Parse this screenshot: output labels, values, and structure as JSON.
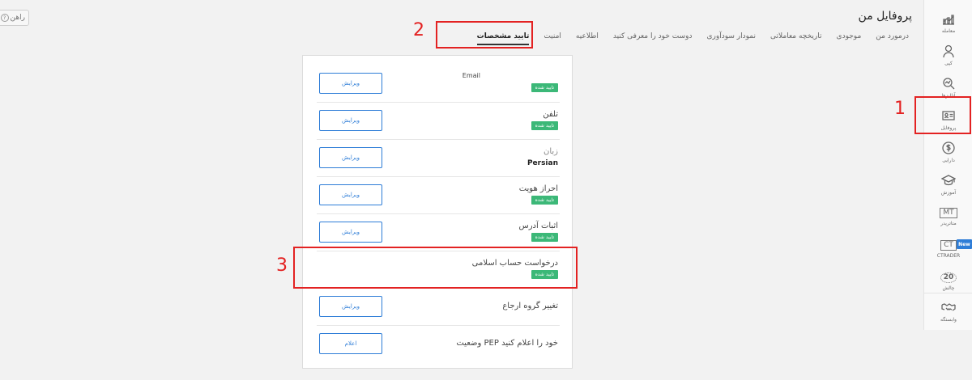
{
  "help": {
    "label": "راهن"
  },
  "page": {
    "title": "پروفایل من"
  },
  "tabs": [
    {
      "label": "درمورد من",
      "active": false
    },
    {
      "label": "موجودی",
      "active": false
    },
    {
      "label": "تاریخچه معاملاتی",
      "active": false
    },
    {
      "label": "نمودار سودآوری",
      "active": false
    },
    {
      "label": "دوست خود را معرفی کنید",
      "active": false
    },
    {
      "label": "اطلاعیه",
      "active": false
    },
    {
      "label": "امنیت",
      "active": false
    },
    {
      "label": "تایید مشخصات",
      "active": true
    }
  ],
  "sidebar": {
    "items": [
      {
        "label": "معامله",
        "icon": "trade-chart-icon"
      },
      {
        "label": "کپی",
        "icon": "copy-user-icon"
      },
      {
        "label": "آنالیزها",
        "icon": "analysis-icon"
      },
      {
        "label": "پروفایل",
        "icon": "profile-card-icon"
      },
      {
        "label": "دارایی",
        "icon": "dollar-icon"
      },
      {
        "label": "آموزش",
        "icon": "education-cap-icon"
      },
      {
        "label": "متاتریدر",
        "icon": "mt-icon",
        "text": "MT"
      },
      {
        "label": "CTRADER",
        "icon": "ct-icon",
        "text": "CT"
      },
      {
        "label": "چالش",
        "icon": "challenge-20-icon",
        "text": "20"
      },
      {
        "label": "وابستگه",
        "icon": "handshake-icon"
      }
    ],
    "new_badge": "New"
  },
  "verification": {
    "verified_label": "تایید شده",
    "rows": [
      {
        "label": "Email",
        "button": "ویرایش"
      },
      {
        "label": "تلفن",
        "button": "ویرایش"
      },
      {
        "label": "زبان",
        "value": "Persian",
        "button": "ویرایش"
      },
      {
        "label": "احراز هویت",
        "button": "ویرایش"
      },
      {
        "label": "اثبات آدرس",
        "button": "ویرایش"
      },
      {
        "label": "درخواست حساب اسلامی"
      },
      {
        "label": "تغییر گروه ارجاع",
        "button": "ویرایش"
      },
      {
        "label": "وضعیت PEP خود را اعلام کنید",
        "button": "اعلام"
      }
    ]
  },
  "annotations": {
    "one": "1",
    "two": "2",
    "three": "3"
  },
  "colors": {
    "accent": "#2e7dd7",
    "verified": "#3cb878",
    "annotation": "#e32222"
  }
}
